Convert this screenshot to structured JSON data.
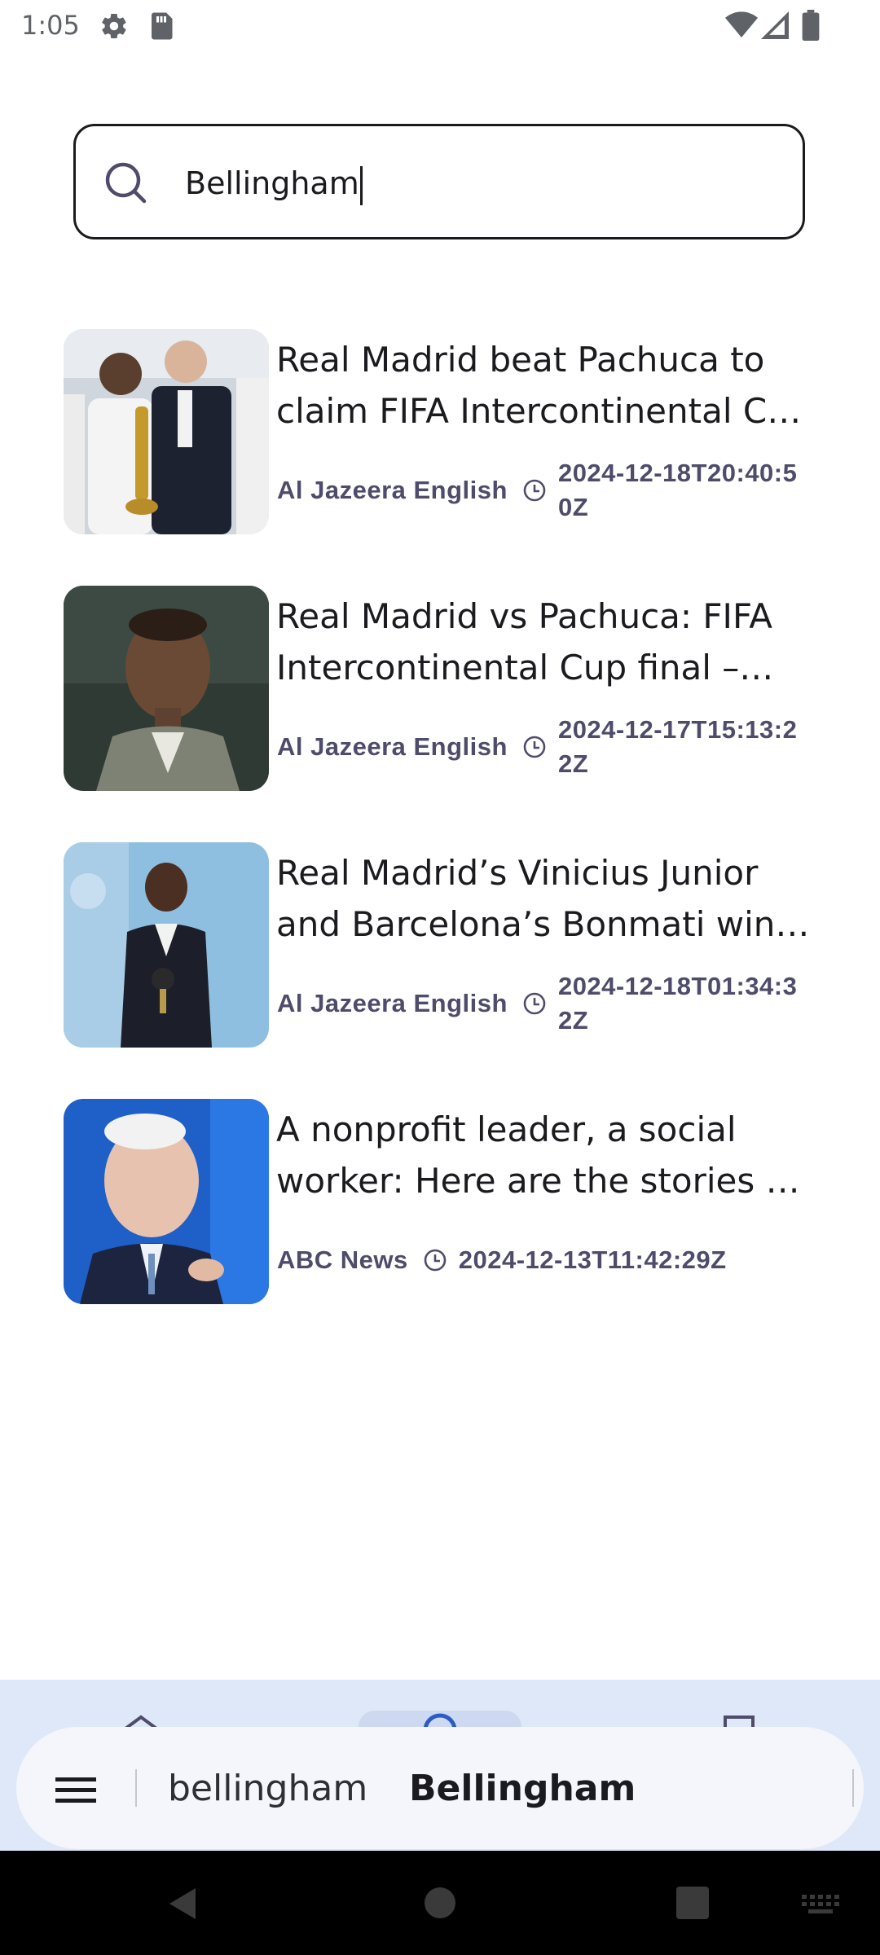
{
  "status_bar": {
    "time": "1:05",
    "icons": [
      "gear-icon",
      "sd-card-icon",
      "wifi-icon",
      "signal-icon",
      "battery-icon"
    ]
  },
  "search": {
    "query": "Bellingham",
    "icon": "search-icon"
  },
  "articles": [
    {
      "title": "Real Madrid beat Pachuca to claim FIFA Intercontinental Cup title",
      "source": "Al Jazeera English",
      "published": "2024-12-18T20:40:50Z",
      "thumbnail": "trophy-celebration-photo"
    },
    {
      "title": "Real Madrid vs Pachuca: FIFA Intercontinental Cup final – team news",
      "source": "Al Jazeera English",
      "published": "2024-12-17T15:13:22Z",
      "thumbnail": "player-portrait-photo"
    },
    {
      "title": "Real Madrid’s Vinicius Junior and Barcelona’s Bonmati win FIFA awards",
      "source": "Al Jazeera English",
      "published": "2024-12-18T01:34:32Z",
      "thumbnail": "award-ceremony-photo"
    },
    {
      "title": "A nonprofit leader, a social worker: Here are the stories of those pardoned",
      "source": "ABC News",
      "published": "2024-12-13T11:42:29Z",
      "thumbnail": "speaker-portrait-photo"
    }
  ],
  "keyboard_suggestions": {
    "menu_icon": "menu-icon",
    "items": [
      "bellingham",
      "Bellingham"
    ]
  },
  "colors": {
    "meta_text": "#4f4c6b",
    "bottom_nav_bg": "#dfe8f8",
    "suggestion_bar_bg": "#f4f6fb"
  }
}
